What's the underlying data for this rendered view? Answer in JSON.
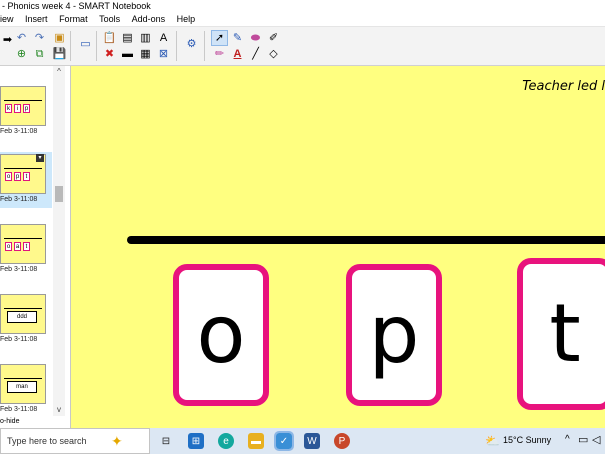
{
  "window": {
    "title": "- Phonics week 4 - SMART Notebook"
  },
  "menu": [
    "iew",
    "Insert",
    "Format",
    "Tools",
    "Add-ons",
    "Help"
  ],
  "sidebar": {
    "thumbnails": [
      {
        "letters": [
          "k",
          "i",
          "p"
        ],
        "label": "Feb 3-11:08",
        "selected": false
      },
      {
        "letters": [
          "o",
          "p",
          "t"
        ],
        "label": "Feb 3-11:08",
        "selected": true
      },
      {
        "letters": [
          "o",
          "a",
          "t"
        ],
        "label": "Feb 3-11:08",
        "selected": false
      },
      {
        "word": "ddd",
        "label": "Feb 3-11:08",
        "selected": false
      },
      {
        "word": "man",
        "label": "Feb 3-11:08",
        "selected": false
      }
    ],
    "autohide_label": "o-hide"
  },
  "canvas": {
    "heading": "Teacher led l",
    "letters": [
      "o",
      "p",
      "t"
    ],
    "colors": {
      "background": "#ffff80",
      "card_border": "#e8137d"
    }
  },
  "taskbar": {
    "search_placeholder": "Type here to search",
    "weather": "15°C  Sunny"
  },
  "icons": [
    "undo-icon",
    "redo-icon",
    "open-icon",
    "save-icon",
    "select-arrow-icon",
    "pen-icon",
    "eraser-icon",
    "text-icon",
    "line-icon",
    "shape-icon",
    "windows-icon",
    "edge-icon",
    "word-icon",
    "powerpoint-icon",
    "notebook-icon"
  ]
}
